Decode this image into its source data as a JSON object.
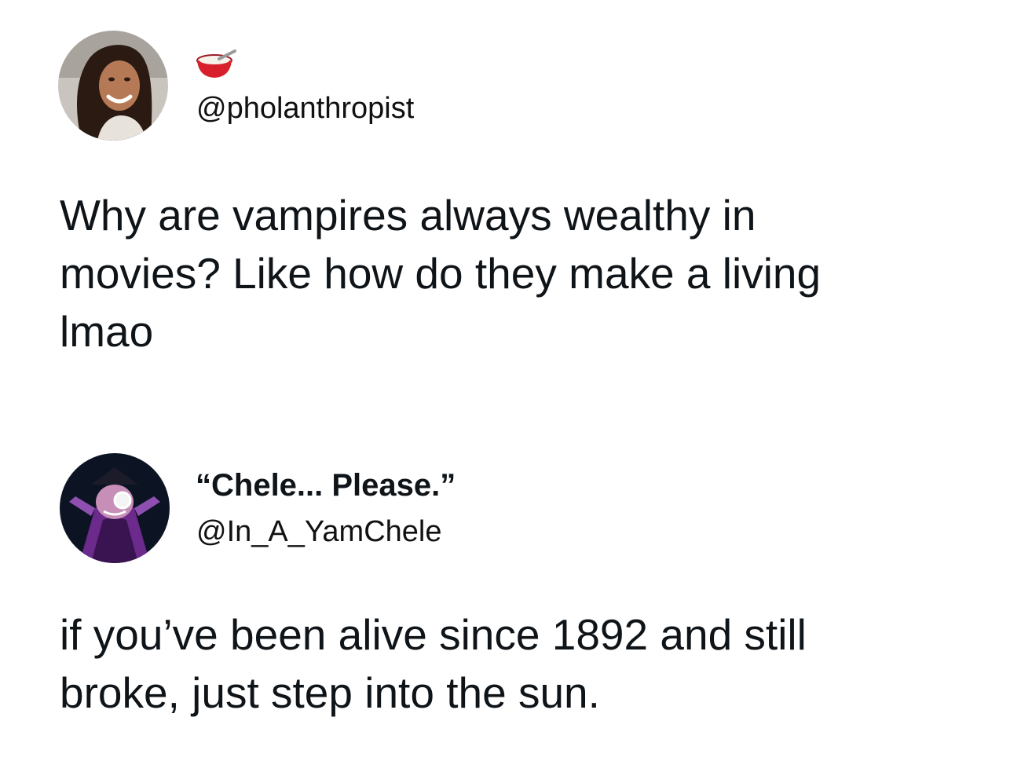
{
  "tweets": [
    {
      "avatar": {
        "icon": "user-photo-avatar"
      },
      "name_emoji": "bowl-emoji",
      "handle": "@pholanthropist",
      "text_lines": [
        "Why are vampires always wealthy in",
        "movies? Like how do they make a living",
        "lmao"
      ]
    },
    {
      "avatar": {
        "icon": "cartoon-character-avatar"
      },
      "display_name": "“Chele... Please.”",
      "handle": "@In_A_YamChele",
      "text_lines": [
        "if you’ve been alive since 1892 and still",
        "broke, just step into the sun."
      ]
    }
  ],
  "colors": {
    "background": "#ffffff",
    "text": "#0f1419",
    "bowl_red": "#d8202c"
  }
}
